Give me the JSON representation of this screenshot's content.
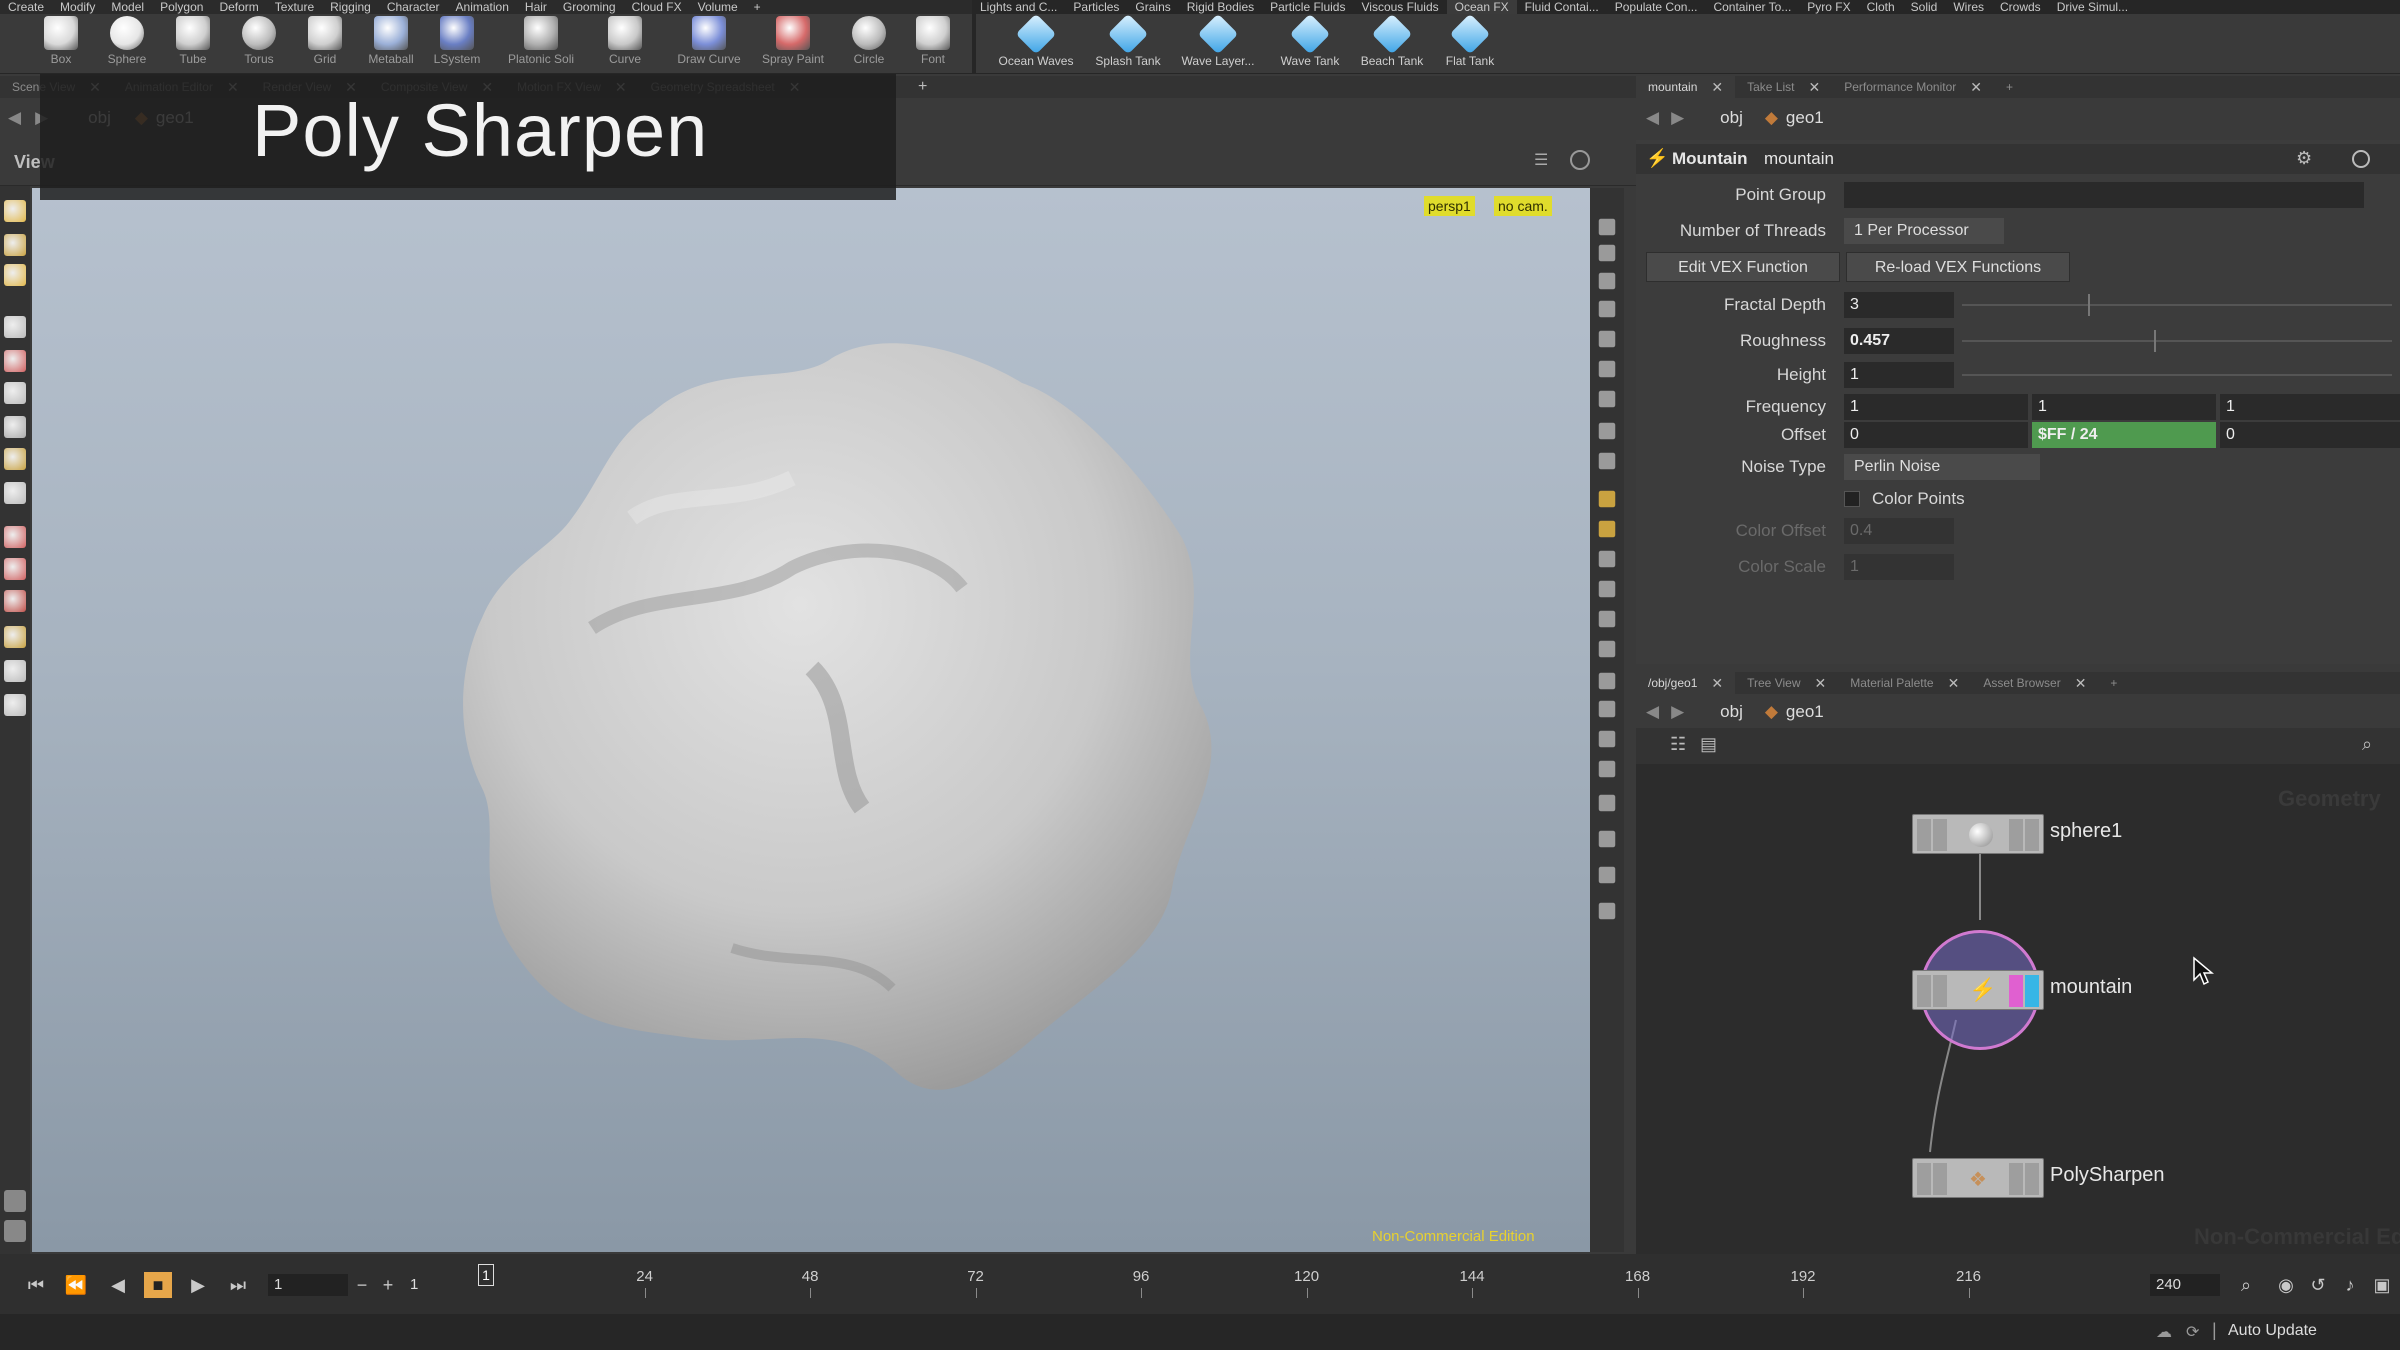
{
  "menubar": {
    "left": [
      "Create",
      "Modify",
      "Model",
      "Polygon",
      "Deform",
      "Texture",
      "Rigging",
      "Character",
      "Animation",
      "Hair",
      "Grooming",
      "Cloud FX",
      "Volume",
      "+"
    ],
    "right": [
      "Lights and C...",
      "Particles",
      "Grains",
      "Rigid Bodies",
      "Particle Fluids",
      "Viscous Fluids",
      "Ocean FX",
      "Fluid Contai...",
      "Populate Con...",
      "Container To...",
      "Pyro FX",
      "Cloth",
      "Solid",
      "Wires",
      "Crowds",
      "Drive Simul..."
    ],
    "active": "Ocean FX"
  },
  "shelf_left": [
    "Box",
    "Sphere",
    "Tube",
    "Torus",
    "Grid",
    "Metaball",
    "LSystem",
    "Platonic Soli...",
    "Curve",
    "Draw Curve",
    "Spray Paint",
    "Circle",
    "Font"
  ],
  "shelf_right": [
    "Ocean Waves",
    "Splash Tank",
    "Wave Layer...",
    "Wave Tank",
    "Beach Tank",
    "Flat Tank"
  ],
  "left_tabs": [
    "Scene View",
    "Animation Editor",
    "Render View",
    "Composite View",
    "Motion FX View",
    "Geometry Spreadsheet"
  ],
  "left_path": {
    "obj": "obj",
    "geo": "geo1"
  },
  "view_label": "View",
  "overlay_title": "Poly Sharpen",
  "viewport": {
    "persp": "persp1",
    "cam": "no cam.",
    "watermark": "Non-Commercial Edition"
  },
  "param_tabs": [
    "mountain",
    "Take List",
    "Performance Monitor"
  ],
  "param_path": {
    "obj": "obj",
    "geo": "geo1"
  },
  "node_header": {
    "type": "Mountain",
    "name": "mountain"
  },
  "params": {
    "point_group": {
      "label": "Point Group",
      "value": ""
    },
    "threads": {
      "label": "Number of Threads",
      "value": "1 Per Processor"
    },
    "edit_vex": "Edit VEX Function",
    "reload_vex": "Re-load VEX Functions",
    "fractal_depth": {
      "label": "Fractal Depth",
      "value": "3",
      "level": 0.3
    },
    "roughness": {
      "label": "Roughness",
      "value": "0.457",
      "level": 0.457
    },
    "height": {
      "label": "Height",
      "value": "1",
      "level": 0.0
    },
    "frequency": {
      "label": "Frequency",
      "values": [
        "1",
        "1",
        "1"
      ]
    },
    "offset": {
      "label": "Offset",
      "values": [
        "0",
        "$FF / 24",
        "0"
      ]
    },
    "noise_type": {
      "label": "Noise Type",
      "value": "Perlin Noise"
    },
    "color_points": {
      "label": "Color Points",
      "checked": false
    },
    "color_offset": {
      "label": "Color Offset",
      "value": "0.4"
    },
    "color_scale": {
      "label": "Color Scale",
      "value": "1"
    }
  },
  "net_tabs": [
    "/obj/geo1",
    "Tree View",
    "Material Palette",
    "Asset Browser"
  ],
  "net_path": {
    "obj": "obj",
    "geo": "geo1"
  },
  "net_watermark": "Geometry",
  "net_watermark2": "Non-Commercial Edition",
  "nodes": [
    {
      "name": "sphere1"
    },
    {
      "name": "mountain"
    },
    {
      "name": "PolySharpen"
    }
  ],
  "timeline": {
    "current_frame": "1",
    "start": "1",
    "end": "240",
    "marker": "1",
    "ticks": [
      "24",
      "48",
      "72",
      "96",
      "120",
      "144",
      "168",
      "192",
      "216"
    ],
    "auto_update": "Auto Update"
  },
  "colors": {
    "accent_yellow": "#e0dc2c",
    "offset_green": "#4f9a4f",
    "selected_node_ring": "#8a7fc9",
    "viewport_top": "#b6c1ce"
  }
}
